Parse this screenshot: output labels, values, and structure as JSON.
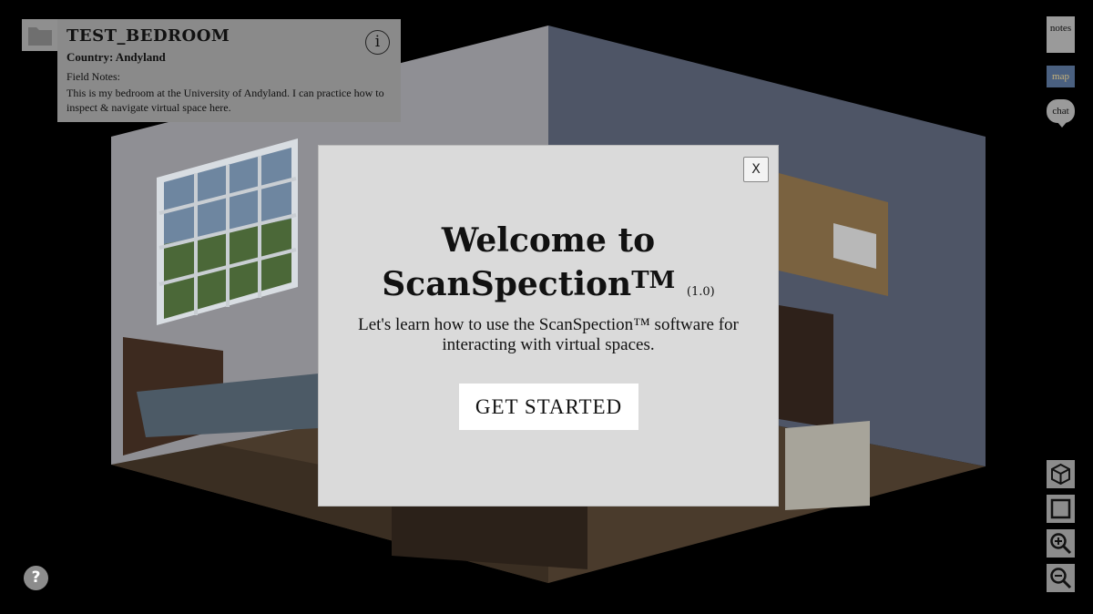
{
  "info_panel": {
    "title": "TEST_BEDROOM",
    "country": "Country: Andyland",
    "notes_label": "Field Notes:",
    "notes_text": "This is my bedroom at the University of Andyland. I can practice how to inspect & navigate virtual space here.",
    "info_icon": "i"
  },
  "side_tools": {
    "notes": "notes",
    "map": "map",
    "chat": "chat"
  },
  "controls": {
    "icons": [
      "cube-view-icon",
      "square-view-icon",
      "zoom-in-icon",
      "zoom-out-icon"
    ]
  },
  "help": {
    "label": "?"
  },
  "modal": {
    "close_label": "X",
    "heading_line1": "Welcome to",
    "heading_line2": "ScanSpection",
    "heading_tm": "TM",
    "heading_version": "(1.0)",
    "description": "Let's learn how to use the ScanSpection™ software for interacting with virtual spaces.",
    "button_label": "GET STARTED"
  },
  "colors": {
    "modal_bg": "#dadada",
    "panel_bg": "#8a8a8a",
    "map_bg": "#4a6080"
  }
}
